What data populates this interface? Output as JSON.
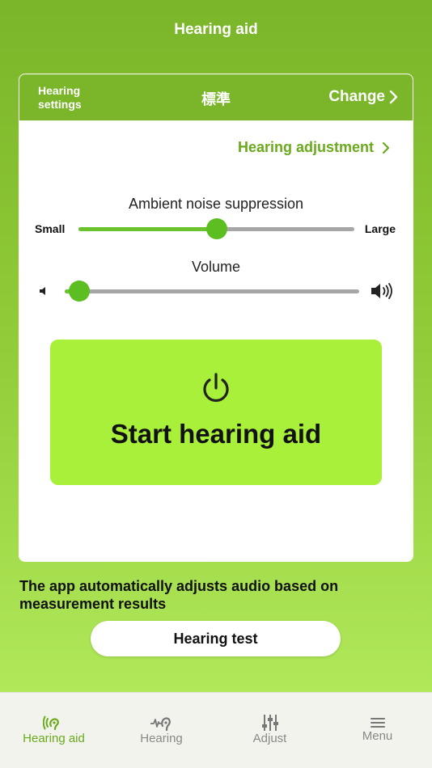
{
  "header": {
    "title": "Hearing aid"
  },
  "settings_card": {
    "settings_label": "Hearing settings",
    "preset": "標準",
    "change_label": "Change",
    "adjustment_link": "Hearing adjustment"
  },
  "noise_slider": {
    "label": "Ambient noise suppression",
    "min_label": "Small",
    "max_label": "Large",
    "value_fraction": 0.5
  },
  "volume_slider": {
    "label": "Volume",
    "value_fraction": 0.05
  },
  "start_button": {
    "label": "Start hearing aid"
  },
  "info_text": "The app automatically adjusts audio based on measurement results",
  "hearing_test_button": {
    "label": "Hearing test"
  },
  "tabs": [
    {
      "label": "Hearing aid",
      "icon": "ear-wave-icon",
      "active": true
    },
    {
      "label": "Hearing",
      "icon": "hearing-test-icon",
      "active": false
    },
    {
      "label": "Adjust",
      "icon": "sliders-icon",
      "active": false
    },
    {
      "label": "Menu",
      "icon": "hamburger-icon",
      "active": false
    }
  ],
  "colors": {
    "accent": "#7ab52a",
    "accent_text": "#6aaa1c",
    "start_button": "#a8f03a",
    "slider_fill": "#6cc22c"
  }
}
